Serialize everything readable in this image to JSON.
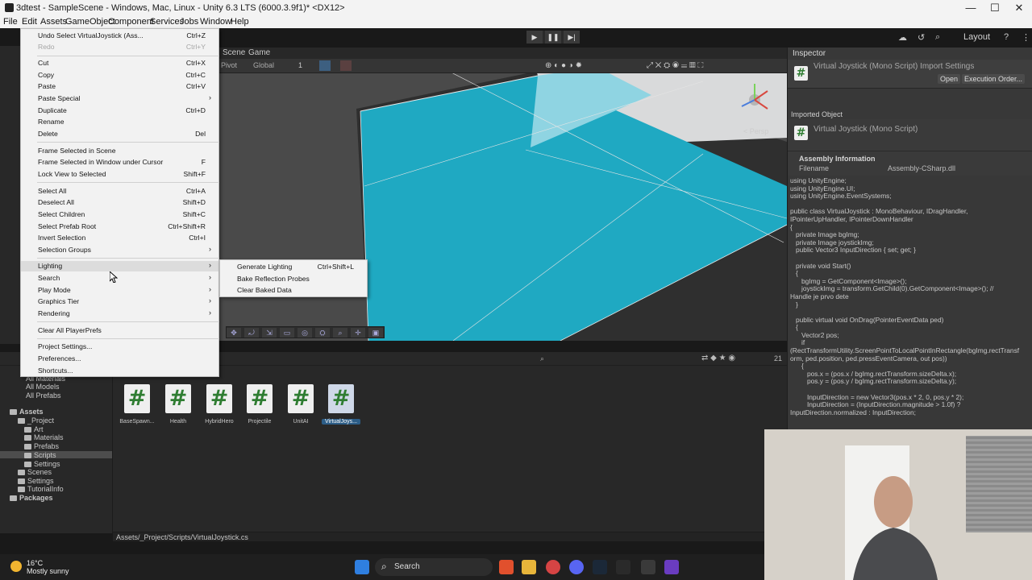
{
  "window": {
    "title": "3dtest - SampleScene - Windows, Mac, Linux - Unity 6.3 LTS (6000.3.9f1)* <DX12>",
    "minimize": "—",
    "maximize": "☐",
    "close": "✕"
  },
  "menubar": [
    "File",
    "Edit",
    "Assets",
    "GameObject",
    "Component",
    "Services",
    "Jobs",
    "Window",
    "Help"
  ],
  "toolbar": {
    "layout_label": "Layout",
    "play_icon": "play-icon",
    "pause_icon": "pause-icon",
    "step_icon": "step-icon"
  },
  "scene": {
    "tabs": [
      "Scene",
      "Game"
    ],
    "pivot": "Pivot",
    "global": "Global",
    "grid_value": "1",
    "persp_label": "< Persp",
    "colors": {
      "sky": "#4a4a4a",
      "plane": "#1fa9c2",
      "plane_light": "#8fd4e2",
      "ground": "#d9dadb"
    }
  },
  "edit_menu": {
    "items": [
      {
        "label": "Undo Select VirtualJoystick (Ass...",
        "shortcut": "Ctrl+Z"
      },
      {
        "label": "Redo",
        "shortcut": "Ctrl+Y",
        "disabled": true
      },
      {
        "label": "Cut",
        "shortcut": "Ctrl+X"
      },
      {
        "label": "Copy",
        "shortcut": "Ctrl+C"
      },
      {
        "label": "Paste",
        "shortcut": "Ctrl+V"
      },
      {
        "label": "Paste Special",
        "shortcut": ""
      },
      {
        "label": "Duplicate",
        "shortcut": "Ctrl+D"
      },
      {
        "label": "Rename",
        "shortcut": ""
      },
      {
        "label": "Delete",
        "shortcut": "Del"
      },
      {
        "label": "Frame Selected in Scene",
        "shortcut": ""
      },
      {
        "label": "Frame Selected in Window under Cursor",
        "shortcut": "F"
      },
      {
        "label": "Lock View to Selected",
        "shortcut": "Shift+F"
      },
      {
        "label": "Select All",
        "shortcut": "Ctrl+A"
      },
      {
        "label": "Deselect All",
        "shortcut": "Shift+D"
      },
      {
        "label": "Select Children",
        "shortcut": "Shift+C"
      },
      {
        "label": "Select Prefab Root",
        "shortcut": "Ctrl+Shift+R"
      },
      {
        "label": "Invert Selection",
        "shortcut": "Ctrl+I"
      },
      {
        "label": "Selection Groups",
        "shortcut": ""
      },
      {
        "label": "Lighting",
        "shortcut": ""
      },
      {
        "label": "Search",
        "shortcut": ""
      },
      {
        "label": "Play Mode",
        "shortcut": ""
      },
      {
        "label": "Graphics Tier",
        "shortcut": ""
      },
      {
        "label": "Rendering",
        "shortcut": ""
      },
      {
        "label": "Clear All PlayerPrefs",
        "shortcut": ""
      },
      {
        "label": "Project Settings...",
        "shortcut": ""
      },
      {
        "label": "Preferences...",
        "shortcut": ""
      },
      {
        "label": "Shortcuts...",
        "shortcut": ""
      }
    ]
  },
  "lighting_submenu": {
    "items": [
      {
        "label": "Generate Lighting",
        "shortcut": "Ctrl+Shift+L"
      },
      {
        "label": "Bake Reflection Probes",
        "shortcut": ""
      },
      {
        "label": "Clear Baked Data",
        "shortcut": ""
      }
    ]
  },
  "project": {
    "tree": [
      "All Materials",
      "All Models",
      "All Prefabs",
      "Assets",
      "_Project",
      "Art",
      "Materials",
      "Prefabs",
      "Scripts",
      "Settings",
      "Scenes",
      "Settings",
      "TutorialInfo",
      "Packages"
    ],
    "assets": [
      "BaseSpawn...",
      "Health",
      "HybridHero",
      "Projectile",
      "UnitAI",
      "VirtualJoys..."
    ],
    "search_count": "21",
    "status_path": "Assets/_Project/Scripts/VirtualJoystick.cs"
  },
  "inspector": {
    "tab": "Inspector",
    "title": "Virtual Joystick (Mono Script) Import Settings",
    "open_button": "Open",
    "exec_button": "Execution Order...",
    "imported_object": "Imported Object",
    "object_name": "Virtual Joystick (Mono Script)",
    "assembly_heading": "Assembly Information",
    "filename_key": "Filename",
    "filename_value": "Assembly-CSharp.dll",
    "code": "using UnityEngine;\nusing UnityEngine.UI;\nusing UnityEngine.EventSystems;\n\npublic class VirtualJoystick : MonoBehaviour, IDragHandler,\nIPointerUpHandler, IPointerDownHandler\n{\n   private Image bgImg;\n   private Image joystickImg;\n   public Vector3 InputDirection { set; get; }\n\n   private void Start()\n   {\n      bgImg = GetComponent<Image>();\n      joystickImg = transform.GetChild(0).GetComponent<Image>(); //\nHandle je prvo dete\n   }\n\n   public virtual void OnDrag(PointerEventData ped)\n   {\n      Vector2 pos;\n      if\n(RectTransformUtility.ScreenPointToLocalPointInRectangle(bgImg.rectTransf\norm, ped.position, ped.pressEventCamera, out pos))\n      {\n         pos.x = (pos.x / bgImg.rectTransform.sizeDelta.x);\n         pos.y = (pos.y / bgImg.rectTransform.sizeDelta.y);\n\n         InputDirection = new Vector3(pos.x * 2, 0, pos.y * 2);\n         InputDirection = (InputDirection.magnitude > 1.0f) ?\nInputDirection.normalized : InputDirection;"
  },
  "taskbar": {
    "temperature": "16°C",
    "weather": "Mostly sunny",
    "search_label": "Search"
  }
}
